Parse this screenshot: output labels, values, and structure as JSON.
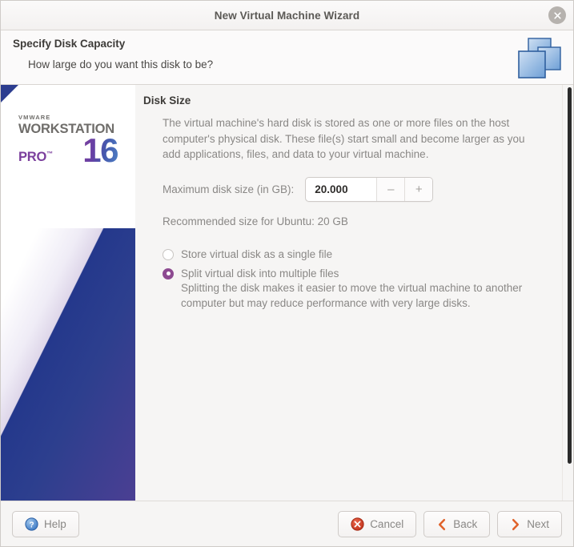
{
  "window": {
    "title": "New Virtual Machine Wizard",
    "close_icon": "close-icon"
  },
  "header": {
    "title": "Specify Disk Capacity",
    "subtitle": "How large do you want this disk to be?",
    "logo_icon": "vmware-squares-logo-icon"
  },
  "sidebar": {
    "brand_top": "VMWARE",
    "brand_main": "WORKSTATION",
    "brand_edition": "PRO",
    "brand_tm": "™",
    "brand_version": "16"
  },
  "main": {
    "section_title": "Disk Size",
    "description": "The virtual machine's hard disk is stored as one or more files on the host computer's physical disk. These file(s) start small and become larger as you add applications, files, and data to your virtual machine.",
    "size_label": "Maximum disk size (in GB):",
    "size_value": "20.000",
    "size_placeholder": "20.000",
    "decrement_label": "–",
    "increment_label": "+",
    "recommended": "Recommended size for Ubuntu: 20 GB",
    "options": [
      {
        "label": "Store virtual disk as a single file",
        "selected": false,
        "sublabel": ""
      },
      {
        "label": "Split virtual disk into multiple files",
        "selected": true,
        "sublabel": "Splitting the disk makes it easier to move the virtual machine to another computer but may reduce performance with very large disks."
      }
    ]
  },
  "footer": {
    "help_label": "Help",
    "cancel_label": "Cancel",
    "back_label": "Back",
    "next_label": "Next",
    "help_icon": "question-circle-icon",
    "cancel_icon": "error-circle-icon",
    "back_icon": "chevron-left-icon",
    "next_icon": "chevron-right-icon"
  },
  "colors": {
    "accent_purple": "#8d4a91",
    "brand_blue": "#2c3d8f",
    "cancel_red": "#cc3a23",
    "nav_orange": "#e0622a",
    "help_blue": "#3b78c4",
    "text_muted": "#8a8886"
  }
}
